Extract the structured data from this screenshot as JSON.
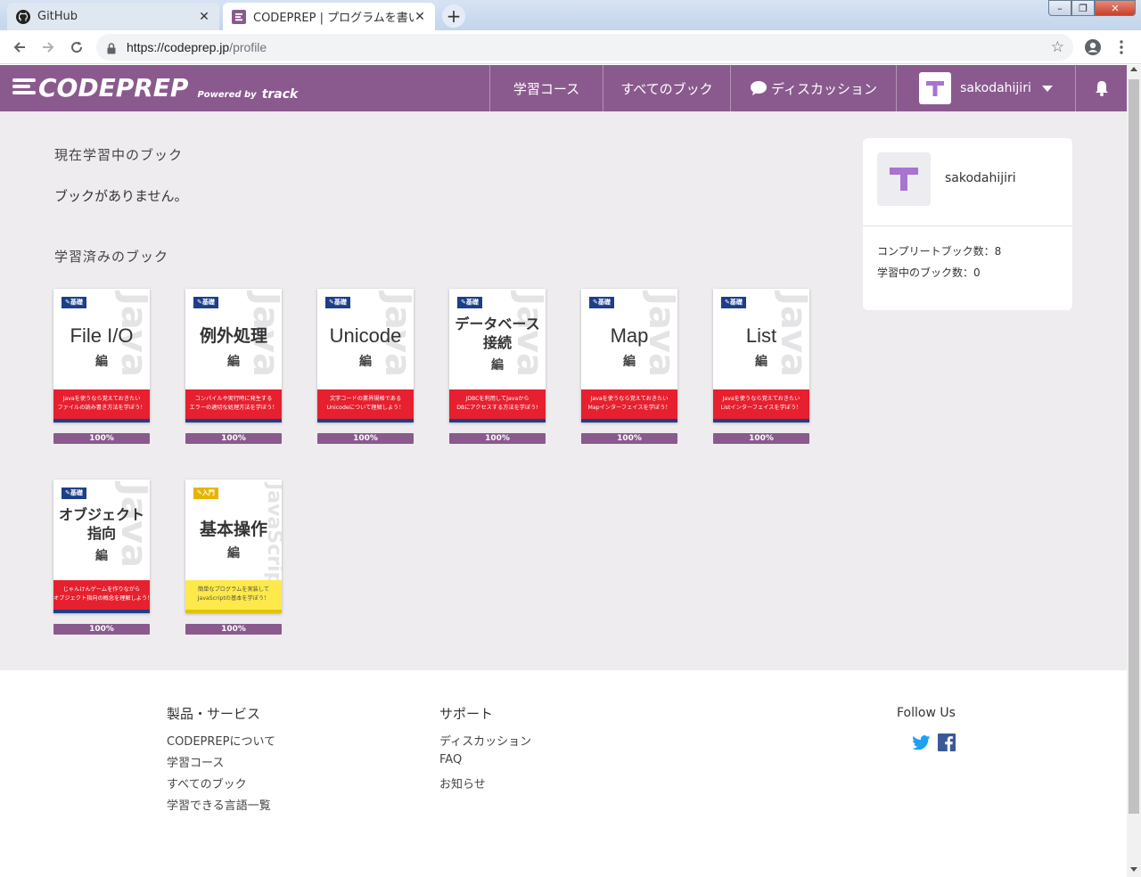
{
  "browser": {
    "tabs": [
      {
        "title": "GitHub"
      },
      {
        "title": "CODEPREP | プログラムを書いて"
      }
    ],
    "url_host": "https://codeprep.jp",
    "url_path": "/profile"
  },
  "header": {
    "logo": "CODEPREP",
    "powered_by": "Powered by",
    "track": "track",
    "nav": {
      "courses": "学習コース",
      "books": "すべてのブック",
      "discussion": "ディスカッション",
      "username": "sakodahijiri"
    }
  },
  "main": {
    "current_title": "現在学習中のブック",
    "current_empty": "ブックがありません。",
    "done_title": "学習済みのブック",
    "books": [
      {
        "lang": "Java",
        "badge": "基礎",
        "title": "File I/O",
        "hen": "編",
        "desc1": "Javaを使うなら覚えておきたい",
        "desc2": "ファイルの読み書き方法を学ぼう！",
        "progress": "100%"
      },
      {
        "lang": "Java",
        "badge": "基礎",
        "title": "例外処理",
        "hen": "編",
        "desc1": "コンパイルや実行時に発生する",
        "desc2": "エラーの適切な処理方法を学ぼう！",
        "progress": "100%"
      },
      {
        "lang": "Java",
        "badge": "基礎",
        "title": "Unicode",
        "hen": "編",
        "desc1": "文字コードの業界規格である",
        "desc2": "Unicodeについて理解しよう！",
        "progress": "100%"
      },
      {
        "lang": "Java",
        "badge": "基礎",
        "title1": "データベース",
        "title2": "接続",
        "hen": "編",
        "desc1": "JDBCを利用してJavaから",
        "desc2": "DBにアクセスする方法を学ぼう!",
        "progress": "100%"
      },
      {
        "lang": "Java",
        "badge": "基礎",
        "title": "Map",
        "hen": "編",
        "desc1": "Javaを使うなら覚えておきたい",
        "desc2": "Mapインターフェイスを学ぼう！",
        "progress": "100%"
      },
      {
        "lang": "Java",
        "badge": "基礎",
        "title": "List",
        "hen": "編",
        "desc1": "Javaを使うなら覚えておきたい",
        "desc2": "Listインターフェイスを学ぼう！",
        "progress": "100%"
      },
      {
        "lang": "Java",
        "badge": "基礎",
        "title1": "オブジェクト",
        "title2": "指向",
        "hen": "編",
        "desc1": "じゃんけんゲームを作りながら",
        "desc2": "オブジェクト指向の概念を理解しよう！",
        "progress": "100%"
      },
      {
        "lang": "JavaScript",
        "badge": "入門",
        "title": "基本操作",
        "hen": "編",
        "desc1": "簡単なプログラムを実装して",
        "desc2": "JavaScriptの基本を学ぼう！",
        "progress": "100%"
      }
    ]
  },
  "profile": {
    "username": "sakodahijiri",
    "completed": "コンプリートブック数：8",
    "learning": "学習中のブック数：0"
  },
  "footer": {
    "products_title": "製品・サービス",
    "products": [
      "CODEPREPについて",
      "学習コース",
      "すべてのブック",
      "学習できる言語一覧"
    ],
    "support_title": "サポート",
    "support": [
      "ディスカッション",
      "FAQ",
      "お知らせ"
    ],
    "follow": "Follow Us"
  },
  "colors": {
    "brand": "#8a5a8e",
    "cover_red": "#e6202e",
    "cover_yellow": "#fde94a",
    "twitter": "#1da1f2",
    "facebook": "#3b5998"
  },
  "icons": [
    "github-icon",
    "codeprep-favicon",
    "back-arrow-icon",
    "forward-arrow-icon",
    "reload-icon",
    "lock-icon",
    "star-icon",
    "account-icon",
    "menu-dots-icon",
    "speech-bubble-icon",
    "bell-icon",
    "twitter-icon",
    "facebook-icon",
    "pencil-icon"
  ]
}
